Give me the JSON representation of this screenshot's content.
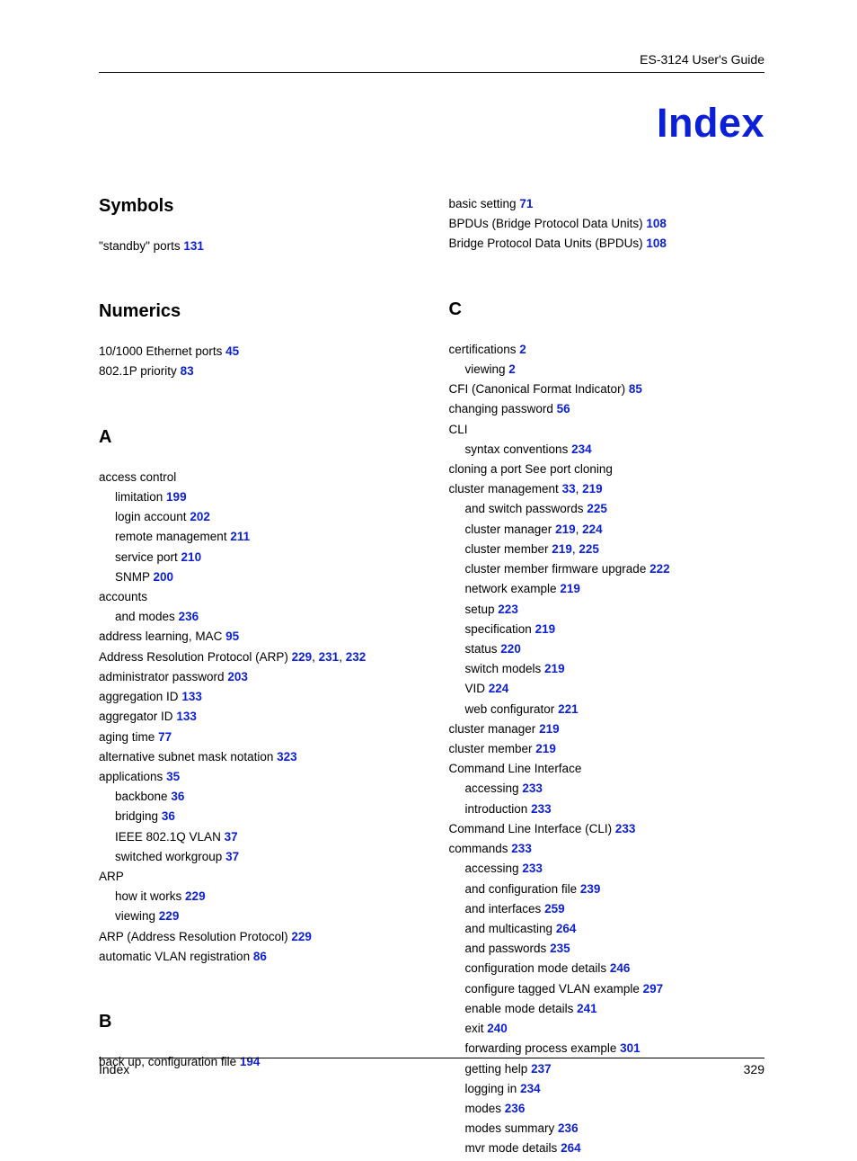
{
  "header": {
    "guide": "ES-3124 User's Guide"
  },
  "title": "Index",
  "footer": {
    "left": "Index",
    "right": "329"
  },
  "left": {
    "symbols": {
      "head": "Symbols",
      "items": [
        {
          "text": "\"standby\" ports",
          "refs": [
            "131"
          ]
        }
      ]
    },
    "numerics": {
      "head": "Numerics",
      "items": [
        {
          "text": "10/1000 Ethernet ports",
          "refs": [
            "45"
          ]
        },
        {
          "text": "802.1P priority",
          "refs": [
            "83"
          ]
        }
      ]
    },
    "a": {
      "head": "A",
      "items": [
        {
          "text": "access control",
          "refs": []
        },
        {
          "text": "limitation",
          "refs": [
            "199"
          ],
          "sub": true
        },
        {
          "text": "login account",
          "refs": [
            "202"
          ],
          "sub": true
        },
        {
          "text": "remote management",
          "refs": [
            "211"
          ],
          "sub": true
        },
        {
          "text": "service port",
          "refs": [
            "210"
          ],
          "sub": true
        },
        {
          "text": "SNMP",
          "refs": [
            "200"
          ],
          "sub": true
        },
        {
          "text": "accounts",
          "refs": []
        },
        {
          "text": "and modes",
          "refs": [
            "236"
          ],
          "sub": true
        },
        {
          "text": "address learning, MAC",
          "refs": [
            "95"
          ]
        },
        {
          "text": "Address Resolution Protocol (ARP)",
          "refs": [
            "229",
            "231",
            "232"
          ]
        },
        {
          "text": "administrator password",
          "refs": [
            "203"
          ]
        },
        {
          "text": "aggregation ID",
          "refs": [
            "133"
          ]
        },
        {
          "text": "aggregator ID",
          "refs": [
            "133"
          ]
        },
        {
          "text": "aging time",
          "refs": [
            "77"
          ]
        },
        {
          "text": "alternative subnet mask notation",
          "refs": [
            "323"
          ]
        },
        {
          "text": "applications",
          "refs": [
            "35"
          ]
        },
        {
          "text": "backbone",
          "refs": [
            "36"
          ],
          "sub": true
        },
        {
          "text": "bridging",
          "refs": [
            "36"
          ],
          "sub": true
        },
        {
          "text": "IEEE 802.1Q VLAN",
          "refs": [
            "37"
          ],
          "sub": true
        },
        {
          "text": "switched workgroup",
          "refs": [
            "37"
          ],
          "sub": true
        },
        {
          "text": "ARP",
          "refs": []
        },
        {
          "text": "how it works",
          "refs": [
            "229"
          ],
          "sub": true
        },
        {
          "text": "viewing",
          "refs": [
            "229"
          ],
          "sub": true
        },
        {
          "text": "ARP (Address Resolution Protocol)",
          "refs": [
            "229"
          ]
        },
        {
          "text": "automatic VLAN registration",
          "refs": [
            "86"
          ]
        }
      ]
    },
    "b": {
      "head": "B",
      "items": [
        {
          "text": "back up, configuration file",
          "refs": [
            "194"
          ]
        }
      ]
    }
  },
  "right": {
    "pre": {
      "items": [
        {
          "text": "basic setting",
          "refs": [
            "71"
          ]
        },
        {
          "text": "BPDUs (Bridge Protocol Data Units)",
          "refs": [
            "108"
          ]
        },
        {
          "text": "Bridge Protocol Data Units (BPDUs)",
          "refs": [
            "108"
          ]
        }
      ]
    },
    "c": {
      "head": "C",
      "items": [
        {
          "text": "certifications",
          "refs": [
            "2"
          ]
        },
        {
          "text": "viewing",
          "refs": [
            "2"
          ],
          "sub": true
        },
        {
          "text": "CFI (Canonical Format Indicator)",
          "refs": [
            "85"
          ]
        },
        {
          "text": "changing password",
          "refs": [
            "56"
          ]
        },
        {
          "text": "CLI",
          "refs": []
        },
        {
          "text": "syntax conventions",
          "refs": [
            "234"
          ],
          "sub": true
        },
        {
          "text": "cloning a port See port cloning",
          "refs": []
        },
        {
          "text": "cluster management",
          "refs": [
            "33",
            "219"
          ]
        },
        {
          "text": "and switch passwords",
          "refs": [
            "225"
          ],
          "sub": true
        },
        {
          "text": "cluster manager",
          "refs": [
            "219",
            "224"
          ],
          "sub": true
        },
        {
          "text": "cluster member",
          "refs": [
            "219",
            "225"
          ],
          "sub": true
        },
        {
          "text": "cluster member firmware upgrade",
          "refs": [
            "222"
          ],
          "sub": true
        },
        {
          "text": "network example",
          "refs": [
            "219"
          ],
          "sub": true
        },
        {
          "text": "setup",
          "refs": [
            "223"
          ],
          "sub": true
        },
        {
          "text": "specification",
          "refs": [
            "219"
          ],
          "sub": true
        },
        {
          "text": "status",
          "refs": [
            "220"
          ],
          "sub": true
        },
        {
          "text": "switch models",
          "refs": [
            "219"
          ],
          "sub": true
        },
        {
          "text": "VID",
          "refs": [
            "224"
          ],
          "sub": true
        },
        {
          "text": "web configurator",
          "refs": [
            "221"
          ],
          "sub": true
        },
        {
          "text": "cluster manager",
          "refs": [
            "219"
          ]
        },
        {
          "text": "cluster member",
          "refs": [
            "219"
          ]
        },
        {
          "text": "Command Line Interface",
          "refs": []
        },
        {
          "text": "accessing",
          "refs": [
            "233"
          ],
          "sub": true
        },
        {
          "text": "introduction",
          "refs": [
            "233"
          ],
          "sub": true
        },
        {
          "text": "Command Line Interface (CLI)",
          "refs": [
            "233"
          ]
        },
        {
          "text": "commands",
          "refs": [
            "233"
          ]
        },
        {
          "text": "accessing",
          "refs": [
            "233"
          ],
          "sub": true
        },
        {
          "text": "and configuration file",
          "refs": [
            "239"
          ],
          "sub": true
        },
        {
          "text": "and interfaces",
          "refs": [
            "259"
          ],
          "sub": true
        },
        {
          "text": "and multicasting",
          "refs": [
            "264"
          ],
          "sub": true
        },
        {
          "text": "and passwords",
          "refs": [
            "235"
          ],
          "sub": true
        },
        {
          "text": "configuration mode details",
          "refs": [
            "246"
          ],
          "sub": true
        },
        {
          "text": "configure tagged VLAN example",
          "refs": [
            "297"
          ],
          "sub": true
        },
        {
          "text": "enable mode details",
          "refs": [
            "241"
          ],
          "sub": true
        },
        {
          "text": "exit",
          "refs": [
            "240"
          ],
          "sub": true
        },
        {
          "text": "forwarding process example",
          "refs": [
            "301"
          ],
          "sub": true
        },
        {
          "text": "getting help",
          "refs": [
            "237"
          ],
          "sub": true
        },
        {
          "text": "logging in",
          "refs": [
            "234"
          ],
          "sub": true
        },
        {
          "text": "modes",
          "refs": [
            "236"
          ],
          "sub": true
        },
        {
          "text": "modes summary",
          "refs": [
            "236"
          ],
          "sub": true
        },
        {
          "text": "mvr mode details",
          "refs": [
            "264"
          ],
          "sub": true
        }
      ]
    }
  }
}
